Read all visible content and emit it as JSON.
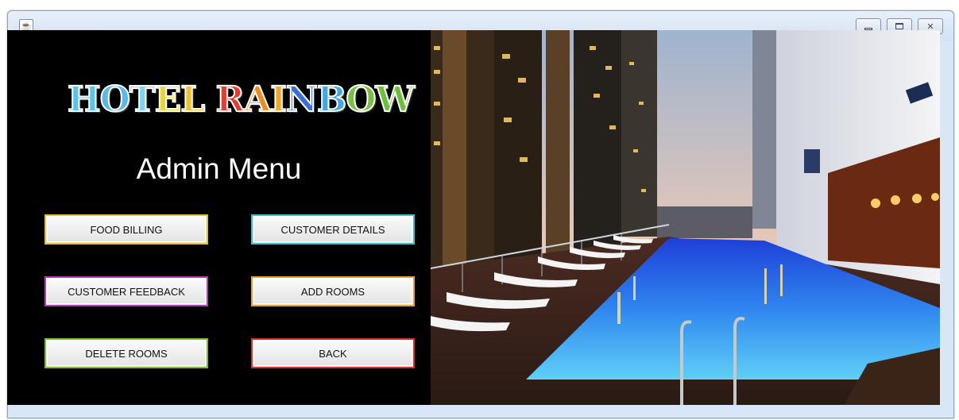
{
  "window": {
    "app_icon": "java-cup-icon",
    "controls": [
      "minimize-icon",
      "maximize-icon",
      "close-icon"
    ],
    "close_glyph": "✕"
  },
  "logo": {
    "letters": [
      {
        "ch": "H",
        "color": "#59c3f0"
      },
      {
        "ch": "O",
        "color": "#5bb8ef"
      },
      {
        "ch": "T",
        "color": "#7ed3f3"
      },
      {
        "ch": "E",
        "color": "#e7d73b"
      },
      {
        "ch": "L",
        "color": "#f2c12e"
      },
      {
        "ch": " ",
        "color": "#ffffff"
      },
      {
        "ch": "R",
        "color": "#e63b2e"
      },
      {
        "ch": "A",
        "color": "#f28a22"
      },
      {
        "ch": "I",
        "color": "#f5a623"
      },
      {
        "ch": "N",
        "color": "#3a6fd8"
      },
      {
        "ch": "B",
        "color": "#42a7e8"
      },
      {
        "ch": "O",
        "color": "#7bc043"
      },
      {
        "ch": "W",
        "color": "#6cbf3a"
      }
    ]
  },
  "title": "Admin Menu",
  "buttons": {
    "food_billing": "FOOD BILLING",
    "customer_details": "CUSTOMER DETAILS",
    "customer_feedback": "CUSTOMER FEEDBACK",
    "add_rooms": "ADD ROOMS",
    "delete_rooms": "DELETE ROOMS",
    "back": "BACK"
  },
  "colors": {
    "background": "#000000",
    "food_billing_border": "#e3c22f",
    "customer_details_border": "#34c6c6",
    "customer_feedback_border": "#b33bb7",
    "add_rooms_border": "#e8a22d",
    "delete_rooms_border": "#7bbf2e",
    "back_border": "#d53030"
  }
}
